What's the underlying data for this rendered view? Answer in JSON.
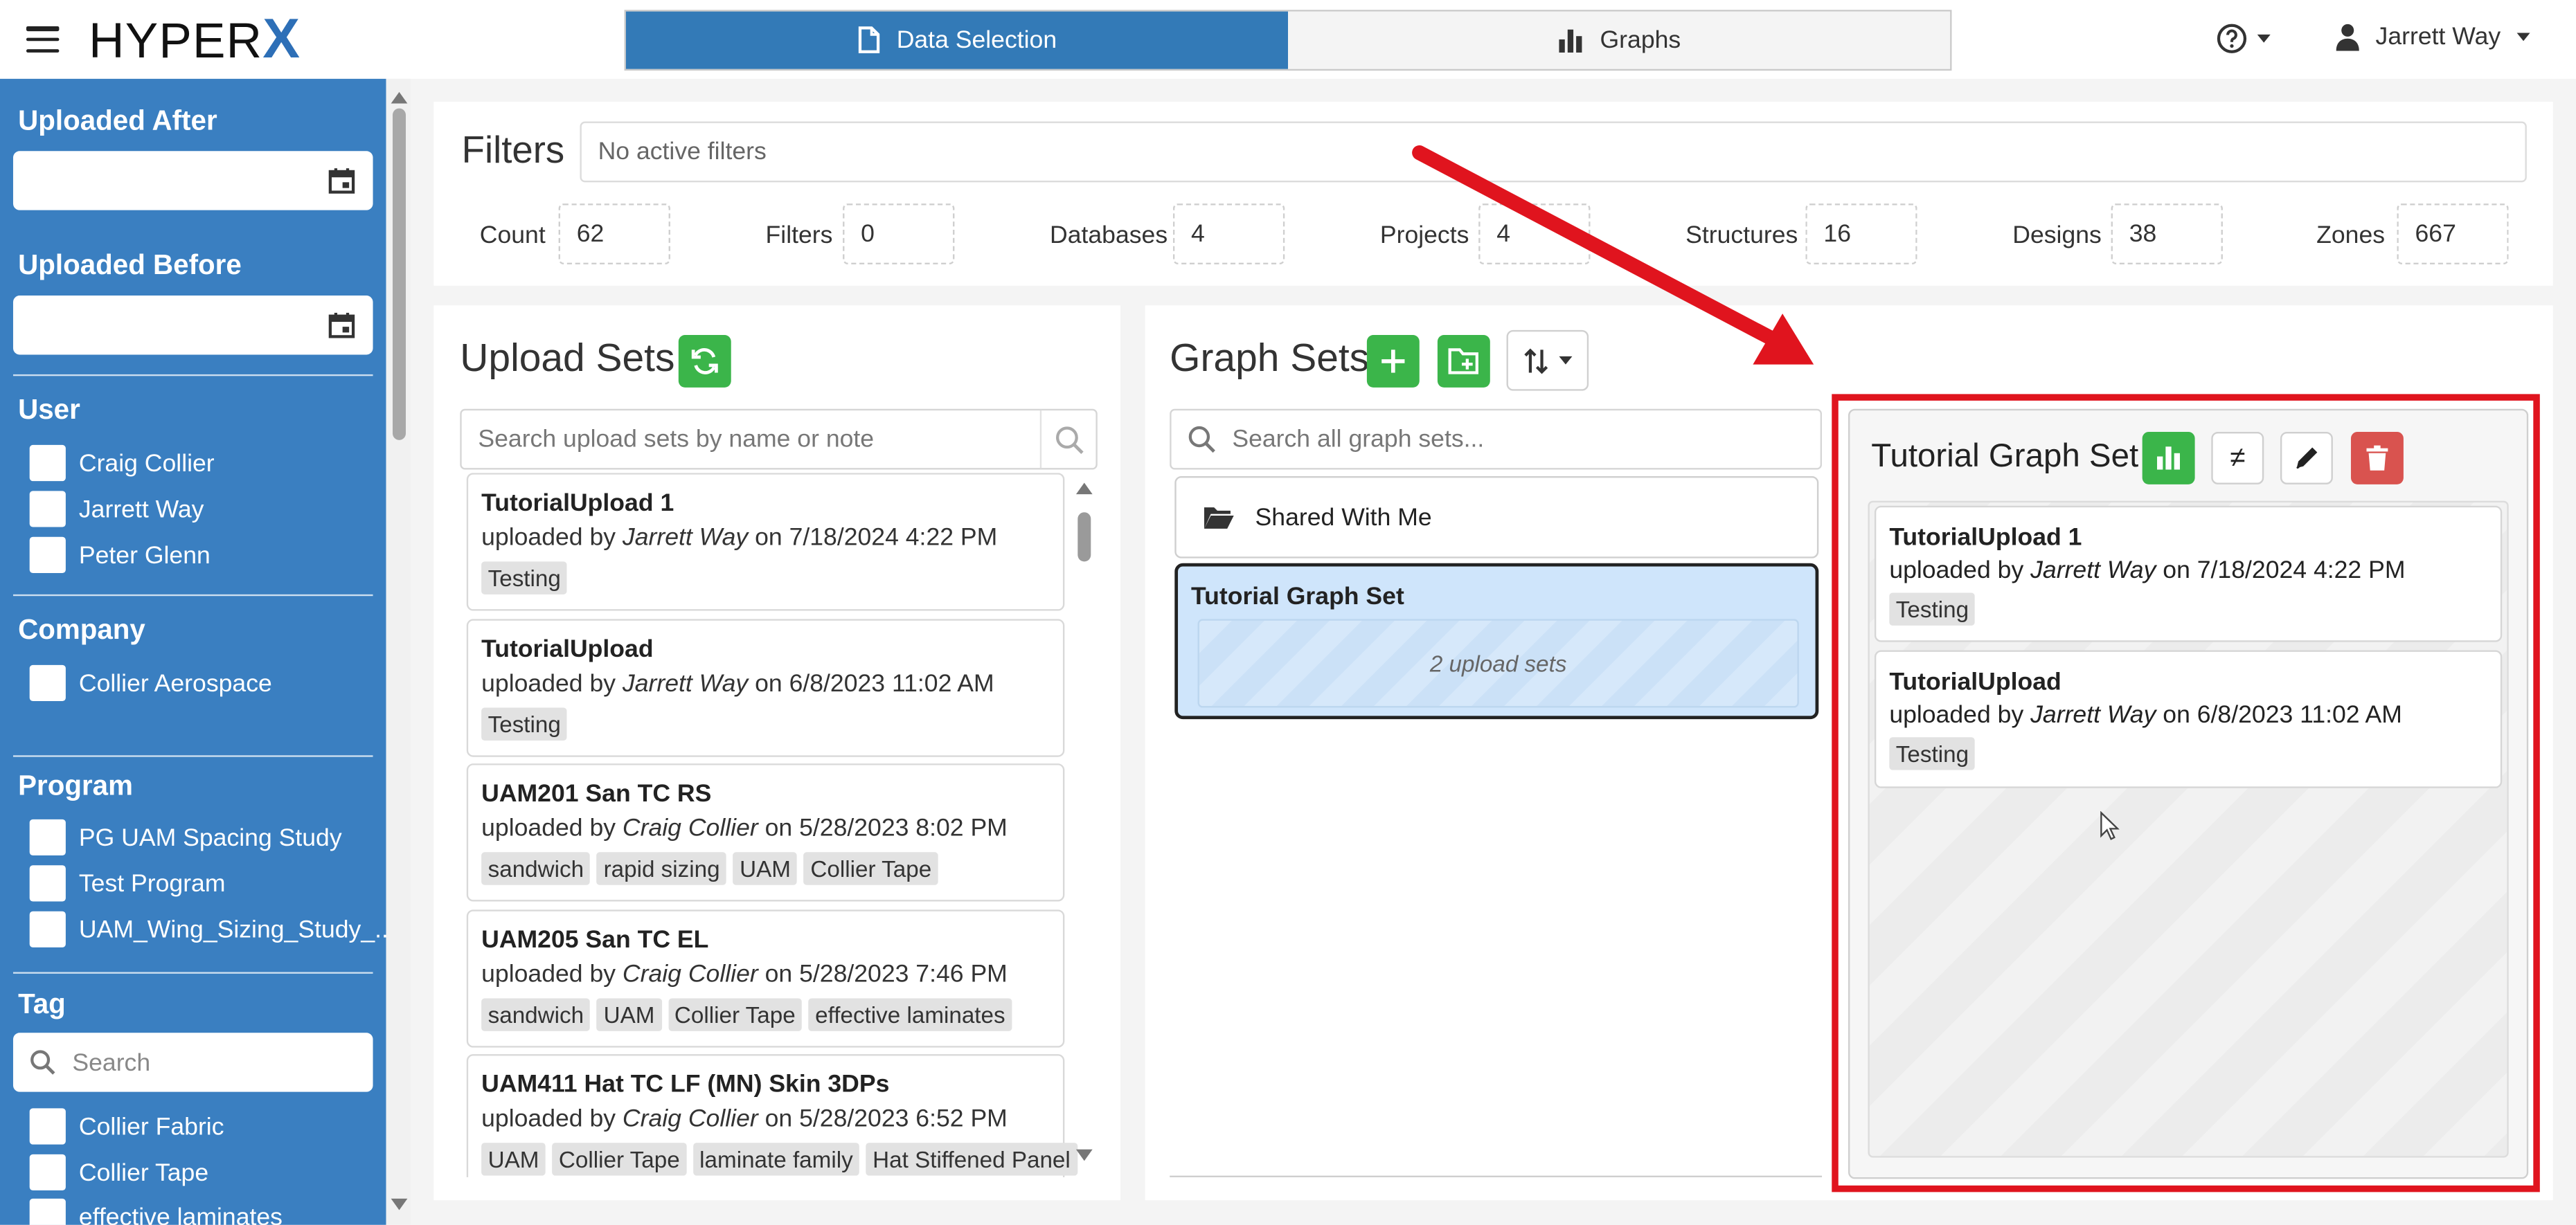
{
  "header": {
    "logo_text": "HYPER",
    "logo_x": "X",
    "tabs": [
      {
        "label": "Data Selection",
        "icon": "document-icon",
        "active": true
      },
      {
        "label": "Graphs",
        "icon": "bar-chart-icon",
        "active": false
      }
    ],
    "user_name": "Jarrett Way"
  },
  "sidebar": {
    "uploaded_after_label": "Uploaded After",
    "uploaded_before_label": "Uploaded Before",
    "user_label": "User",
    "users": [
      "Craig Collier",
      "Jarrett Way",
      "Peter Glenn"
    ],
    "company_label": "Company",
    "companies": [
      "Collier Aerospace"
    ],
    "program_label": "Program",
    "programs": [
      "PG UAM Spacing Study",
      "Test Program",
      "UAM_Wing_Sizing_Study_..."
    ],
    "tag_label": "Tag",
    "tag_search_placeholder": "Search",
    "tags": [
      "Collier Fabric",
      "Collier Tape",
      "effective laminates"
    ]
  },
  "filters": {
    "title": "Filters",
    "active_text": "No active filters",
    "stats": [
      {
        "label": "Count",
        "value": "62"
      },
      {
        "label": "Filters",
        "value": "0"
      },
      {
        "label": "Databases",
        "value": "4"
      },
      {
        "label": "Projects",
        "value": "4"
      },
      {
        "label": "Structures",
        "value": "16"
      },
      {
        "label": "Designs",
        "value": "38"
      },
      {
        "label": "Zones",
        "value": "667"
      }
    ]
  },
  "upload_sets": {
    "title": "Upload Sets",
    "search_placeholder": "Search upload sets by name or note",
    "items": [
      {
        "name": "TutorialUpload 1",
        "by_prefix": "uploaded by ",
        "user": "Jarrett Way",
        "date": " on 7/18/2024 4:22 PM",
        "tags": [
          "Testing"
        ]
      },
      {
        "name": "TutorialUpload",
        "by_prefix": "uploaded by ",
        "user": "Jarrett Way",
        "date": " on 6/8/2023 11:02 AM",
        "tags": [
          "Testing"
        ]
      },
      {
        "name": "UAM201 San TC RS",
        "by_prefix": "uploaded by ",
        "user": "Craig Collier",
        "date": " on 5/28/2023 8:02 PM",
        "tags": [
          "sandwich",
          "rapid sizing",
          "UAM",
          "Collier Tape"
        ]
      },
      {
        "name": "UAM205 San TC EL",
        "by_prefix": "uploaded by ",
        "user": "Craig Collier",
        "date": " on 5/28/2023 7:46 PM",
        "tags": [
          "sandwich",
          "UAM",
          "Collier Tape",
          "effective laminates"
        ]
      },
      {
        "name": "UAM411 Hat TC LF (MN) Skin 3DPs",
        "by_prefix": "uploaded by ",
        "user": "Craig Collier",
        "date": " on 5/28/2023 6:52 PM",
        "tags": [
          "UAM",
          "Collier Tape",
          "laminate family",
          "Hat Stiffened Panel"
        ]
      }
    ]
  },
  "graph_sets": {
    "title": "Graph Sets",
    "search_placeholder": "Search all graph sets...",
    "shared_label": "Shared With Me",
    "selected_name": "Tutorial Graph Set",
    "selected_count": "2 upload sets"
  },
  "detail": {
    "title": "Tutorial Graph Set",
    "not_equal_symbol": "≠",
    "items": [
      {
        "name": "TutorialUpload 1",
        "by_prefix": "uploaded by ",
        "user": "Jarrett Way",
        "date": " on 7/18/2024 4:22 PM",
        "tags": [
          "Testing"
        ]
      },
      {
        "name": "TutorialUpload",
        "by_prefix": "uploaded by ",
        "user": "Jarrett Way",
        "date": " on 6/8/2023 11:02 AM",
        "tags": [
          "Testing"
        ]
      }
    ]
  },
  "colors": {
    "sidebar": "#3a7fc1",
    "active_tab": "#337ab7",
    "green": "#3bb54a",
    "red": "#d9534f",
    "highlight_frame": "#e0141e",
    "selected_bg": "#cfe5fb"
  }
}
